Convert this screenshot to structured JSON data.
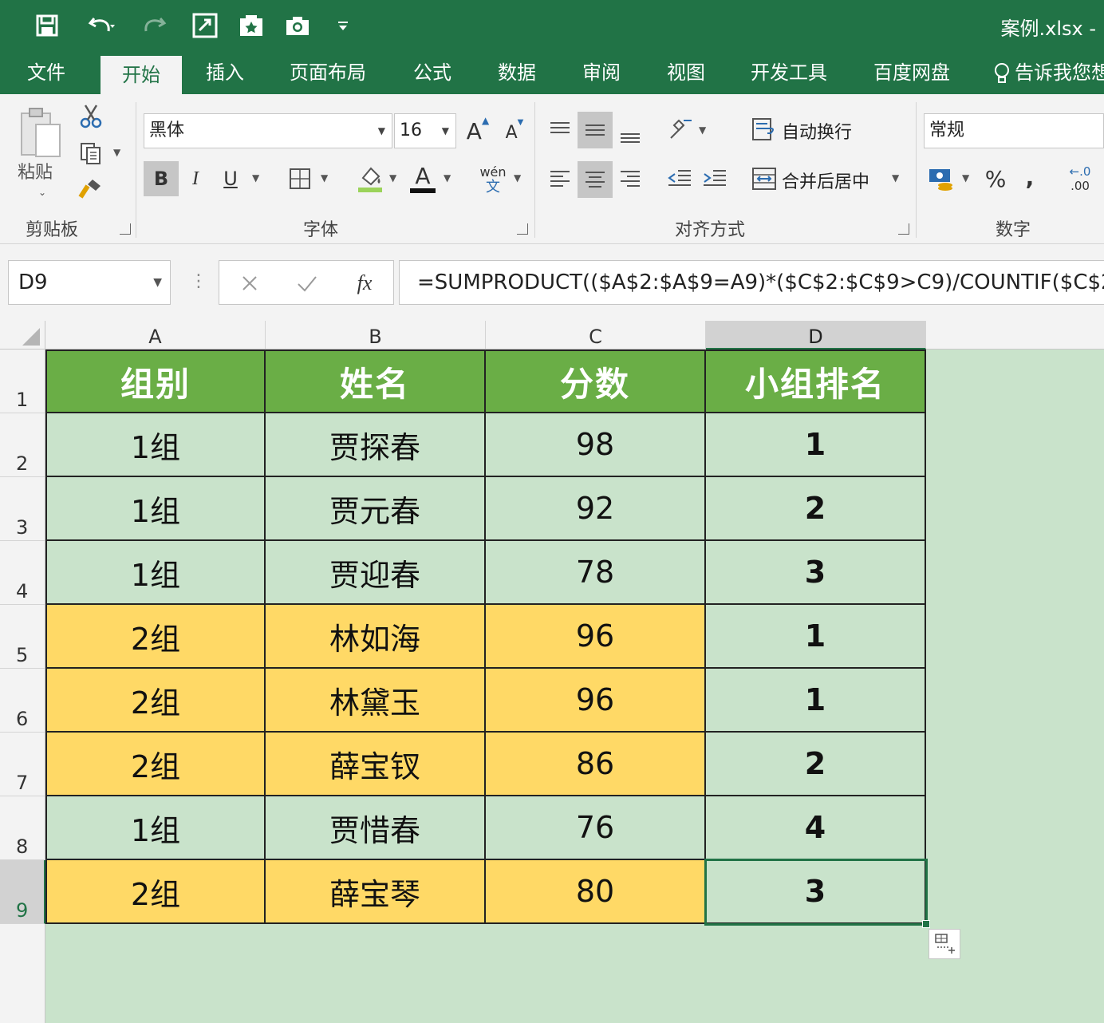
{
  "title_bar": {
    "document_title": "案例.xlsx -"
  },
  "tabs": [
    "文件",
    "开始",
    "插入",
    "页面布局",
    "公式",
    "数据",
    "审阅",
    "视图",
    "开发工具",
    "百度网盘",
    "告诉我您想"
  ],
  "ribbon": {
    "clipboard": {
      "paste_label": "粘贴",
      "group_label": "剪贴板"
    },
    "font": {
      "font_name": "黑体",
      "font_size": "16",
      "bold": "B",
      "italic": "I",
      "underline": "U",
      "grow": "A",
      "shrink": "A",
      "font_color": "A",
      "phonetic_top": "wén",
      "phonetic_bottom": "文",
      "group_label": "字体"
    },
    "alignment": {
      "wrap_text": "自动换行",
      "merge_center": "合并后居中",
      "group_label": "对齐方式"
    },
    "number": {
      "format": "常规",
      "percent": "%",
      "comma": ",",
      "decimal_top": "←.0",
      "decimal_bottom": ".00",
      "group_label": "数字"
    }
  },
  "formula_bar": {
    "name_box": "D9",
    "fx": "fx",
    "formula": "=SUMPRODUCT(($A$2:$A$9=A9)*($C$2:$C$9>C9)/COUNTIF($C$2"
  },
  "sheet": {
    "columns": [
      "A",
      "B",
      "C",
      "D"
    ],
    "row_numbers": [
      "1",
      "2",
      "3",
      "4",
      "5",
      "6",
      "7",
      "8",
      "9"
    ],
    "header": [
      "组别",
      "姓名",
      "分数",
      "小组排名"
    ],
    "rows": [
      {
        "group": "1组",
        "name": "贾探春",
        "score": "98",
        "rank": "1",
        "fill": "g1"
      },
      {
        "group": "1组",
        "name": "贾元春",
        "score": "92",
        "rank": "2",
        "fill": "g1"
      },
      {
        "group": "1组",
        "name": "贾迎春",
        "score": "78",
        "rank": "3",
        "fill": "g1"
      },
      {
        "group": "2组",
        "name": "林如海",
        "score": "96",
        "rank": "1",
        "fill": "g2"
      },
      {
        "group": "2组",
        "name": "林黛玉",
        "score": "96",
        "rank": "1",
        "fill": "g2"
      },
      {
        "group": "2组",
        "name": "薛宝钗",
        "score": "86",
        "rank": "2",
        "fill": "g2"
      },
      {
        "group": "1组",
        "name": "贾惜春",
        "score": "76",
        "rank": "4",
        "fill": "g1"
      },
      {
        "group": "2组",
        "name": "薛宝琴",
        "score": "80",
        "rank": "3",
        "fill": "g2"
      }
    ],
    "selected_cell": "D9"
  },
  "colors": {
    "excel_green": "#217346",
    "header_green": "#6aae46",
    "group1_fill": "#c9e3cb",
    "group2_fill": "#ffd966"
  }
}
